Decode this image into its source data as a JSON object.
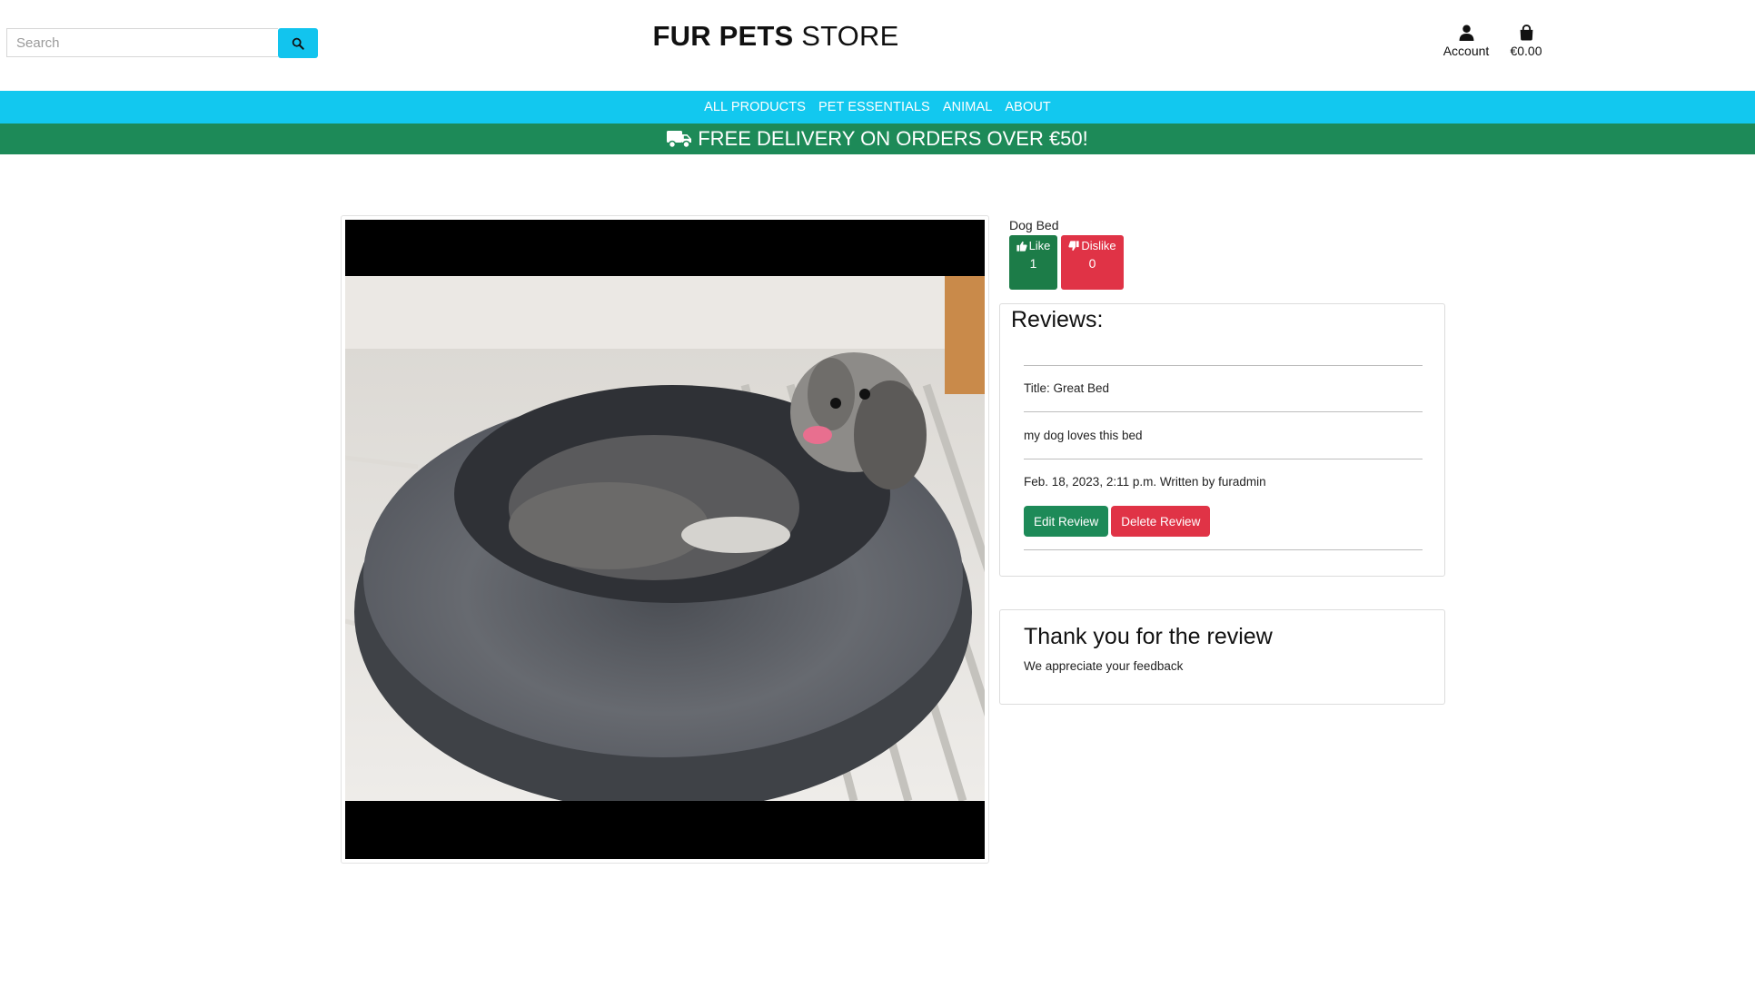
{
  "header": {
    "search_placeholder": "Search",
    "brand_bold": "FUR PETS",
    "brand_light": "STORE",
    "account_label": "Account",
    "bag_total": "€0.00"
  },
  "nav": {
    "items": [
      "ALL PRODUCTS",
      "PET ESSENTIALS",
      "ANIMAL",
      "ABOUT"
    ]
  },
  "banner": {
    "text": "FREE DELIVERY ON ORDERS OVER €50!"
  },
  "product": {
    "name": "Dog Bed",
    "like_label": "Like",
    "like_count": "1",
    "dislike_label": "Dislike",
    "dislike_count": "0"
  },
  "reviews": {
    "heading": "Reviews:",
    "items": [
      {
        "title": "Title: Great Bed",
        "body": "my dog loves this bed",
        "meta": "Feb. 18, 2023, 2:11 p.m. Written by furadmin",
        "edit_label": "Edit Review",
        "delete_label": "Delete Review"
      }
    ]
  },
  "thanks": {
    "title": "Thank you for the review",
    "text": "We appreciate your feedback"
  },
  "colors": {
    "nav_bg": "#12c8ef",
    "banner_bg": "#1d8a58",
    "like_bg": "#1c7c48",
    "dislike_bg": "#e03346"
  }
}
